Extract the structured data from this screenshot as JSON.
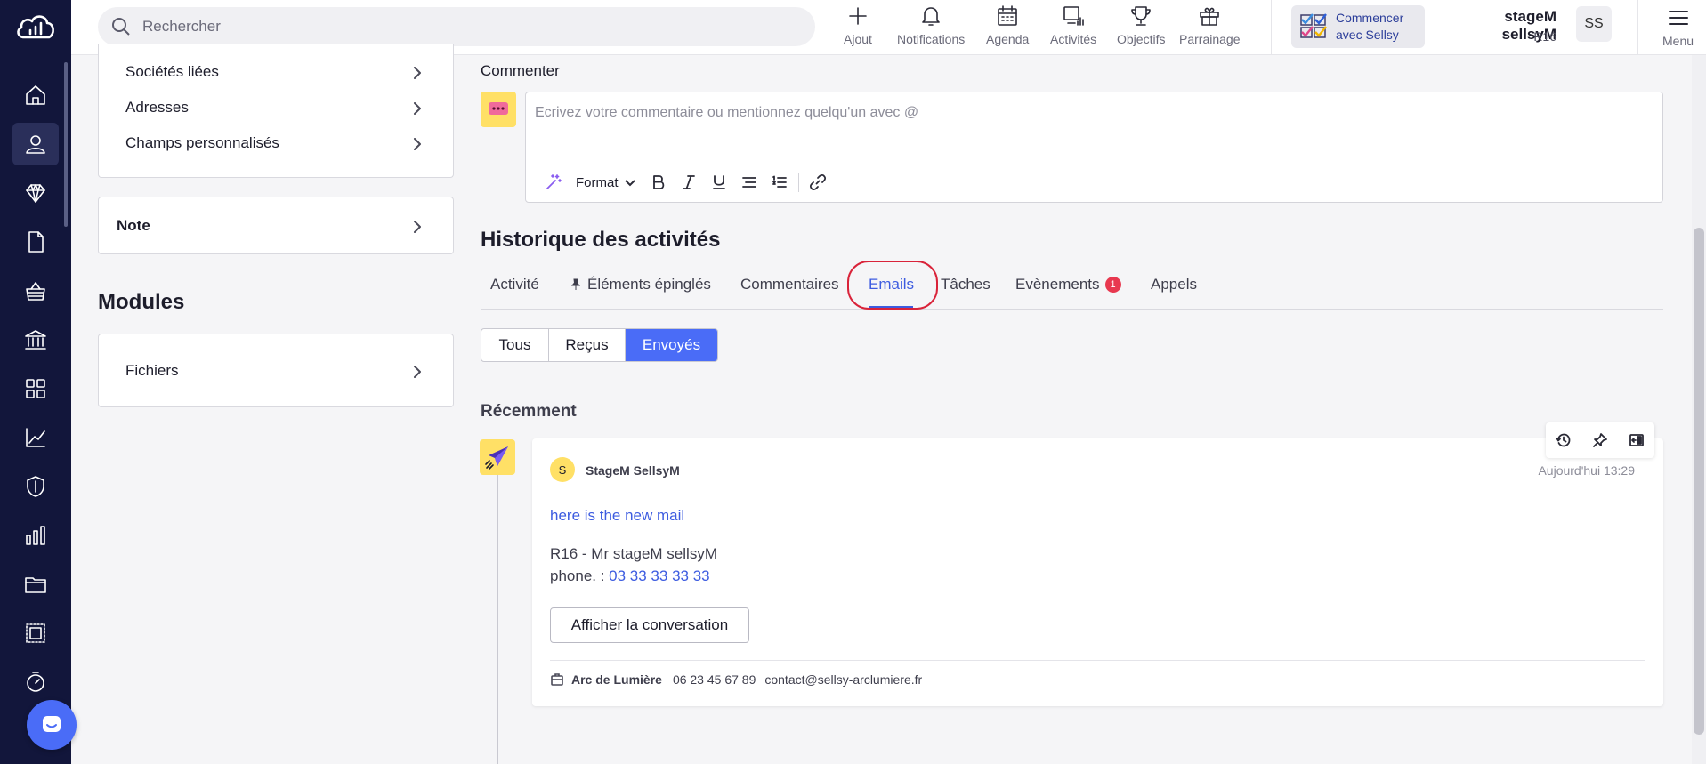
{
  "search": {
    "placeholder": "Rechercher"
  },
  "top_tools": [
    {
      "label": "Ajout",
      "icon": "plus-icon"
    },
    {
      "label": "Notifications",
      "icon": "bell-icon"
    },
    {
      "label": "Agenda",
      "icon": "calendar-icon"
    },
    {
      "label": "Activités",
      "icon": "activities-icon"
    },
    {
      "label": "Objectifs",
      "icon": "trophy-icon"
    },
    {
      "label": "Parrainage",
      "icon": "gift-icon"
    }
  ],
  "start_box": {
    "line1": "Commencer",
    "line2": "avec Sellsy"
  },
  "user": {
    "name": "stageM sellsyM",
    "sub": "R16",
    "initials": "SS"
  },
  "menu": {
    "label": "Menu"
  },
  "left_nav": [
    {
      "icon": "home-icon"
    },
    {
      "icon": "contacts-icon",
      "active": true
    },
    {
      "icon": "diamond-icon"
    },
    {
      "icon": "document-icon"
    },
    {
      "icon": "basket-icon"
    },
    {
      "icon": "bank-icon"
    },
    {
      "icon": "apps-grid-icon"
    },
    {
      "icon": "chart-line-icon"
    },
    {
      "icon": "shield-icon"
    },
    {
      "icon": "bar-chart-icon"
    },
    {
      "icon": "folder-icon"
    },
    {
      "icon": "stamp-icon"
    },
    {
      "icon": "timer-icon"
    }
  ],
  "left_panel": {
    "links": [
      "Sociétés liées",
      "Adresses",
      "Champs personnalisés"
    ],
    "note_label": "Note",
    "modules_title": "Modules",
    "files_label": "Fichiers"
  },
  "comment": {
    "label": "Commenter",
    "placeholder": "Ecrivez votre commentaire ou mentionnez quelqu'un avec @",
    "format_label": "Format"
  },
  "history": {
    "title": "Historique des activités",
    "tabs": [
      "Activité",
      "Éléments épinglés",
      "Commentaires",
      "Emails",
      "Tâches",
      "Evènements",
      "Appels"
    ],
    "active_tab": "Emails",
    "events_badge": "1",
    "filters": [
      "Tous",
      "Reçus",
      "Envoyés"
    ],
    "active_filter": "Envoyés",
    "recent_title": "Récemment"
  },
  "email": {
    "sender_initial": "S",
    "sender_name": "StageM SellsyM",
    "time": "Aujourd'hui 13:29",
    "subject": "here is the new mail",
    "body_line1": "R16 - Mr stageM sellsyM",
    "body_phone_prefix": "phone. : ",
    "body_phone": "03 33 33 33 33",
    "conversation_button": "Afficher la conversation",
    "company": "Arc de Lumière",
    "company_phone": "06 23 45 67 89",
    "company_email": "contact@sellsy-arclumiere.fr"
  },
  "colors": {
    "nav_bg": "#12163b",
    "accent": "#4a6cf7",
    "link": "#3d5ce0",
    "highlight": "#d9233a",
    "badge": "#e8384f",
    "yellow": "#ffe066"
  }
}
